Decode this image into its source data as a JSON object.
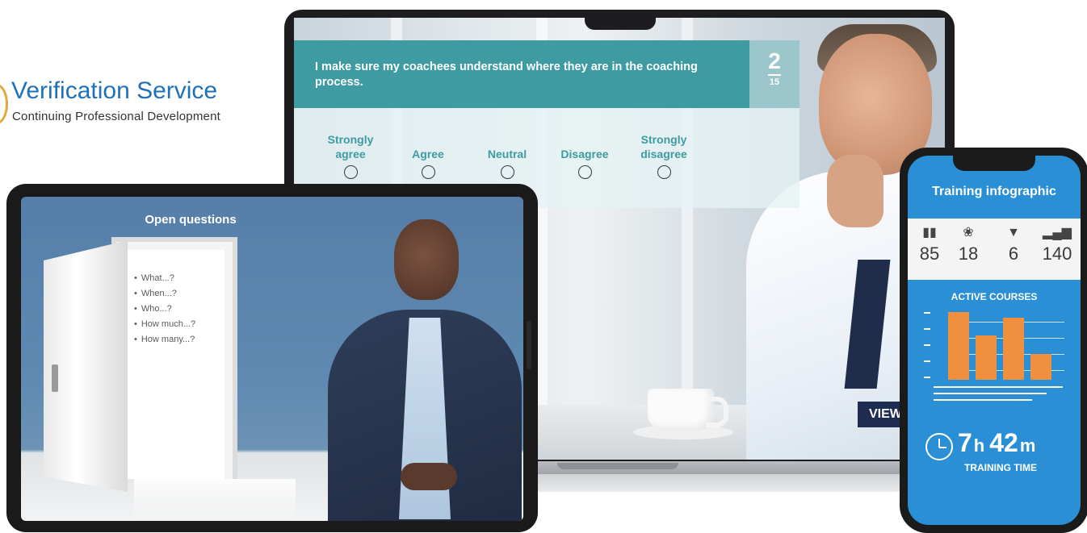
{
  "logo": {
    "title": "Verification Service",
    "subtitle": "Continuing Professional Development",
    "accent": "#1f72b8"
  },
  "laptop": {
    "quiz": {
      "question": "I make sure my coachees understand where they are in the coaching process.",
      "current": "2",
      "total": "15",
      "options": [
        "Strongly agree",
        "Agree",
        "Neutral",
        "Disagree",
        "Strongly disagree"
      ],
      "header_color": "#3d9ba1"
    },
    "view_button": "VIEW"
  },
  "tablet": {
    "title": "Open questions",
    "questions": [
      "What...?",
      "When...?",
      "Who...?",
      "How much...?",
      "How many...?"
    ]
  },
  "phone": {
    "title": "Training infographic",
    "stats": [
      {
        "icon": "book-icon",
        "value": "85"
      },
      {
        "icon": "award-icon",
        "value": "18"
      },
      {
        "icon": "shield-icon",
        "value": "6"
      },
      {
        "icon": "bar-chart-icon",
        "value": "140"
      }
    ],
    "active_label": "ACTIVE COURSES",
    "chart_data": {
      "type": "bar",
      "values": [
        0.95,
        0.62,
        0.88,
        0.36
      ],
      "bar_color": "#f0903e"
    },
    "time_hours": "7",
    "time_hours_unit": "h",
    "time_minutes": "42",
    "time_minutes_unit": "m",
    "time_label": "TRAINING TIME",
    "background": "#2b8fd6"
  }
}
